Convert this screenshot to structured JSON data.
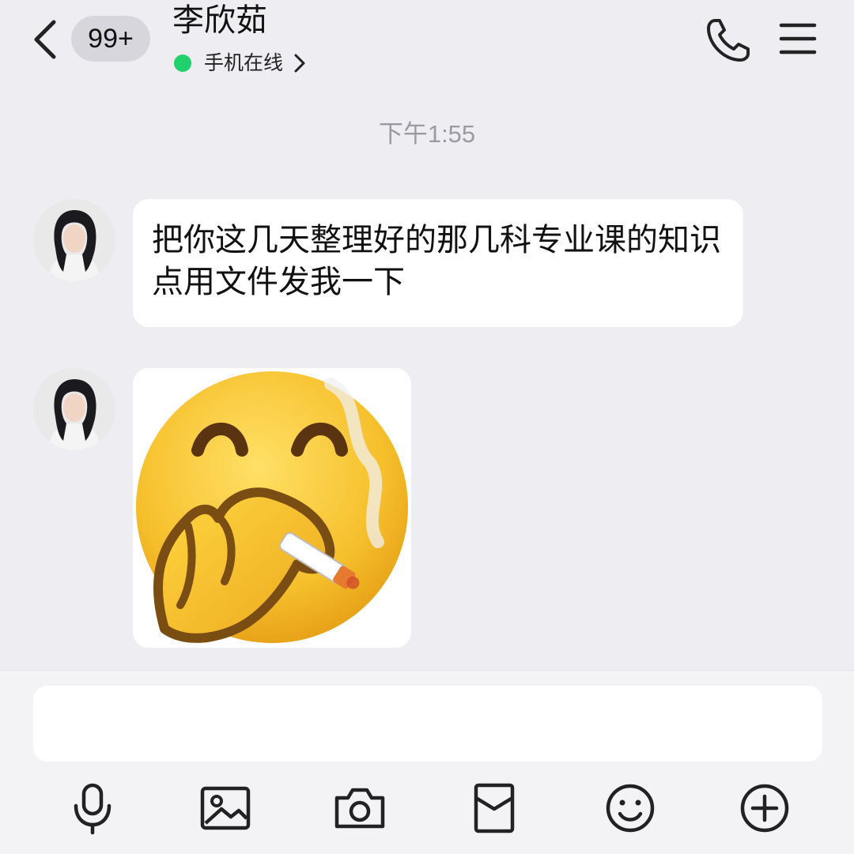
{
  "header": {
    "back_label": "back",
    "unread_badge": "99+",
    "contact_name": "李欣茹",
    "status_text": "手机在线",
    "status_color": "#1fd26b"
  },
  "chat": {
    "timestamp": "下午1:55",
    "messages": [
      {
        "type": "text",
        "sender": "contact",
        "text": "把你这几天整理好的那几科专业课的知识点用文件发我一下"
      },
      {
        "type": "sticker",
        "sender": "contact",
        "sticker": "smirking-face-smoking-emoji"
      }
    ]
  },
  "input": {
    "value": "",
    "placeholder": ""
  },
  "toolbar": {
    "icons": [
      "microphone-icon",
      "image-icon",
      "camera-icon",
      "red-packet-icon",
      "emoji-icon",
      "plus-icon"
    ]
  }
}
